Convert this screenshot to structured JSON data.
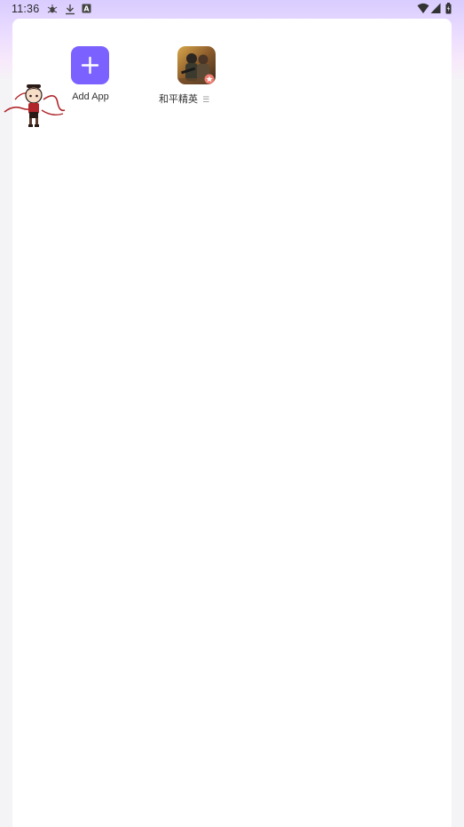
{
  "status_bar": {
    "time": "11:36",
    "left_icons": [
      "bug-icon",
      "download-icon",
      "keyboard-a-icon"
    ],
    "right_icons": [
      "wifi-icon",
      "cell-signal-icon",
      "battery-icon"
    ]
  },
  "colors": {
    "accent": "#7b61ff",
    "header_gradient_top": "#d9ccff",
    "panel_bg": "#ffffff",
    "page_bg": "#f4f4f6"
  },
  "apps": [
    {
      "label": "Add App",
      "icon": "plus-icon"
    },
    {
      "label": "和平精英",
      "icon": "game-icon",
      "badge": "star-badge-icon",
      "suffix": "☰"
    }
  ],
  "floating_widget": {
    "icon": "mascot-icon"
  }
}
